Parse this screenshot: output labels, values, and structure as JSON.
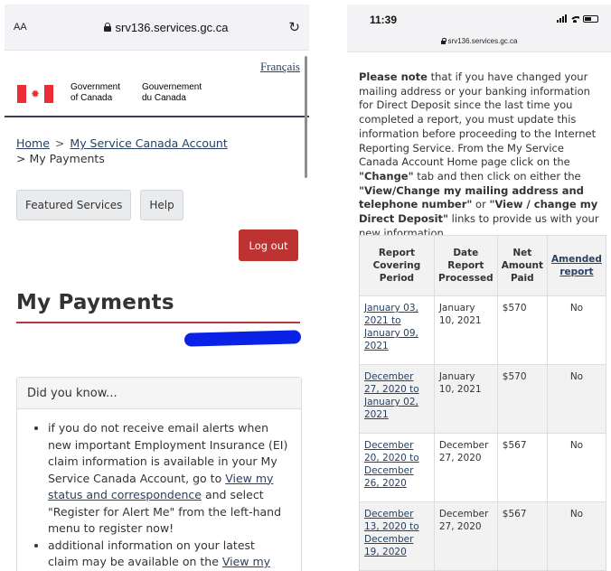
{
  "left_phone": {
    "browser": {
      "aa_label": "AA",
      "url": "srv136.services.gc.ca",
      "reload_icon": "reload-icon"
    },
    "header": {
      "language_link": "Français",
      "gov_en_line1": "Government",
      "gov_en_line2": "of Canada",
      "gov_fr_line1": "Gouvernement",
      "gov_fr_line2": "du Canada"
    },
    "breadcrumb": {
      "home": "Home",
      "separator": ">",
      "account": "My Service Canada Account",
      "current": "> My Payments"
    },
    "nav": {
      "featured": "Featured Services",
      "help": "Help",
      "logout": "Log out"
    },
    "page_title": "My Payments",
    "did_you_know": {
      "heading": "Did you know...",
      "item1_pre": "if you do not receive email alerts when new important Employment Insurance (EI) claim information is available in your My Service Canada Account, go to ",
      "item1_link": "View my status and correspondence",
      "item1_post": " and select \"Register for Alert Me\" from the left-hand menu to register now!",
      "item2_pre": "additional information on your latest claim may be available on the ",
      "item2_link": "View my"
    }
  },
  "right_phone": {
    "status": {
      "time": "11:39",
      "url": "srv136.services.gc.ca"
    },
    "note": {
      "bold_intro": "Please note",
      "text1": " that if you have changed your mailing address or your banking information for Direct Deposit since the last time you completed a report, you must update this information before proceeding to the Internet Reporting Service. From the My Service Canada Account Home page click on the ",
      "change": "\"Change\"",
      "text2": " tab and then click on either the ",
      "link1": "\"View/Change my mailing address and telephone number\"",
      "text3": " or ",
      "link2": "\"View / change my Direct Deposit\"",
      "text4": " links to provide us with your new information."
    },
    "table": {
      "headers": [
        "Report Covering Period",
        "Date Report Processed",
        "Net Amount Paid",
        "Amended report"
      ],
      "rows": [
        {
          "period": "January 03, 2021 to January 09, 2021",
          "processed": "January 10, 2021",
          "amount": "$570",
          "amended": "No"
        },
        {
          "period": "December 27, 2020 to January 02, 2021",
          "processed": "January 10, 2021",
          "amount": "$570",
          "amended": "No"
        },
        {
          "period": "December 20, 2020 to December 26, 2020",
          "processed": "December 27, 2020",
          "amount": "$567",
          "amended": "No"
        },
        {
          "period": "December 13, 2020 to December 19, 2020",
          "processed": "December 27, 2020",
          "amount": "$567",
          "amended": "No"
        }
      ]
    }
  },
  "colors": {
    "link": "#284162",
    "logout_bg": "#bc3331",
    "title_rule": "#af3c43",
    "redaction": "#0a22e6",
    "flag_red": "#eb2d37"
  }
}
